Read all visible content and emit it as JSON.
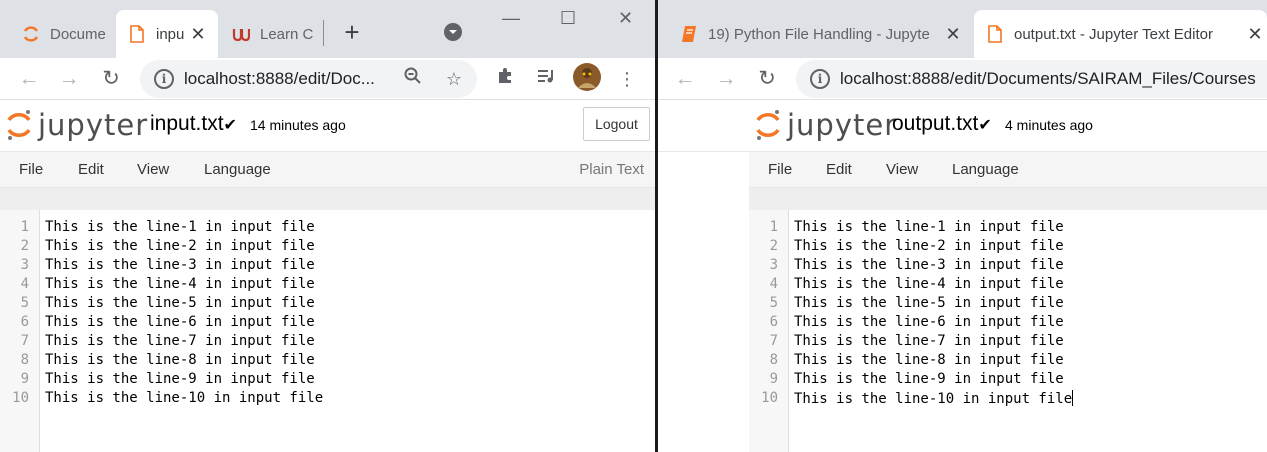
{
  "left_window": {
    "tabs": [
      {
        "title": "Docume",
        "icon": "jupyter-favicon",
        "active": false
      },
      {
        "title": "inpu",
        "icon": "file-favicon",
        "active": true
      },
      {
        "title": "Learn C",
        "icon": "udemy-favicon",
        "active": false
      }
    ],
    "new_tab": "+",
    "url": "localhost:8888/edit/Doc...",
    "header": {
      "filename": "input.txt",
      "saved": "14 minutes ago",
      "logout_label": "Logout"
    },
    "menu": [
      "File",
      "Edit",
      "View",
      "Language"
    ],
    "mode": "Plain Text",
    "lines": [
      {
        "n": "1",
        "text": "This is the line-1 in input file"
      },
      {
        "n": "2",
        "text": "This is the line-2 in input file"
      },
      {
        "n": "3",
        "text": "This is the line-3 in input file"
      },
      {
        "n": "4",
        "text": "This is the line-4 in input file"
      },
      {
        "n": "5",
        "text": "This is the line-5 in input file"
      },
      {
        "n": "6",
        "text": "This is the line-6 in input file"
      },
      {
        "n": "7",
        "text": "This is the line-7 in input file"
      },
      {
        "n": "8",
        "text": "This is the line-8 in input file"
      },
      {
        "n": "9",
        "text": "This is the line-9 in input file"
      },
      {
        "n": "10",
        "text": "This is the line-10 in input file"
      }
    ]
  },
  "right_window": {
    "tabs": [
      {
        "title": "19) Python File Handling - Jupyte",
        "icon": "notebook-favicon",
        "active": false
      },
      {
        "title": "output.txt - Jupyter Text Editor",
        "icon": "file-favicon",
        "active": true
      }
    ],
    "url": "localhost:8888/edit/Documents/SAIRAM_Files/Courses",
    "header": {
      "filename": "output.txt",
      "saved": "4 minutes ago"
    },
    "menu": [
      "File",
      "Edit",
      "View",
      "Language"
    ],
    "lines": [
      {
        "n": "1",
        "text": "This is the line-1 in input file"
      },
      {
        "n": "2",
        "text": "This is the line-2 in input file"
      },
      {
        "n": "3",
        "text": "This is the line-3 in input file"
      },
      {
        "n": "4",
        "text": "This is the line-4 in input file"
      },
      {
        "n": "5",
        "text": "This is the line-5 in input file"
      },
      {
        "n": "6",
        "text": "This is the line-6 in input file"
      },
      {
        "n": "7",
        "text": "This is the line-7 in input file"
      },
      {
        "n": "8",
        "text": "This is the line-8 in input file"
      },
      {
        "n": "9",
        "text": "This is the line-9 in input file"
      },
      {
        "n": "10",
        "text": "This is the line-10 in input file"
      }
    ]
  },
  "colors": {
    "jupyter_orange": "#f37726",
    "udemy_red": "#a435f0",
    "tabstrip": "#dee1e6",
    "gutter": "#f7f7f7"
  }
}
